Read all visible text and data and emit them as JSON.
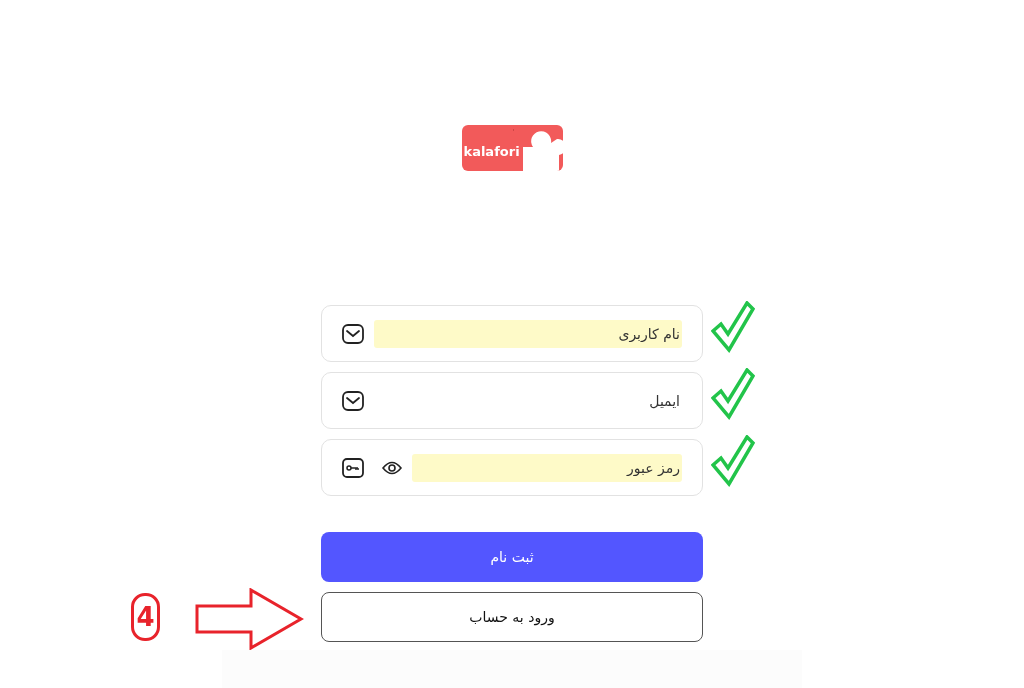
{
  "logo": {
    "text": "kalafori"
  },
  "fields": [
    {
      "kind": "user",
      "placeholder": "نام کاربری",
      "autofilled": true,
      "valid": true
    },
    {
      "kind": "email",
      "placeholder": "ایمیل",
      "autofilled": false,
      "valid": true
    },
    {
      "kind": "password",
      "placeholder": "رمز عبور",
      "autofilled": true,
      "valid": true
    }
  ],
  "buttons": [
    {
      "kind": "primary",
      "label": "ثبت نام"
    },
    {
      "kind": "outline",
      "label": "ورود به حساب"
    }
  ],
  "annotation": {
    "step": "4"
  }
}
